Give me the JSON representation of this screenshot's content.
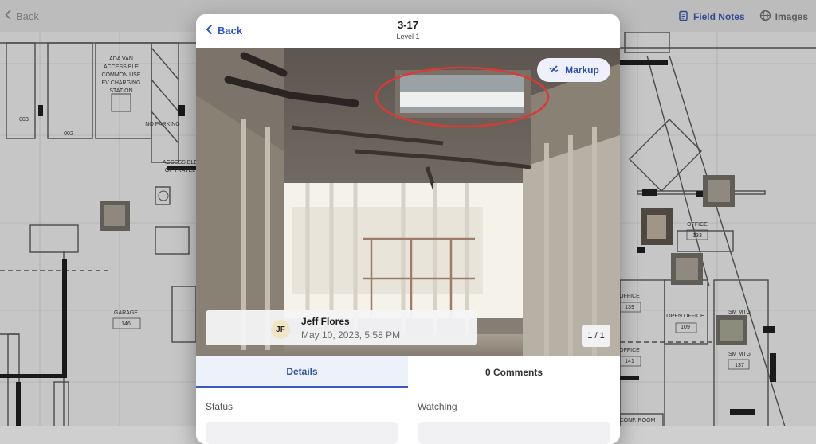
{
  "topbar": {
    "back_label": "Back",
    "field_notes_label": "Field Notes",
    "images_label": "Images",
    "accent_color": "#3b57a8"
  },
  "plan": {
    "labels": [
      "ADA VAN",
      "ACCESSIBLE",
      "COMMON USE",
      "EV CHARGING",
      "STATION",
      "003",
      "002",
      "NO PARKING",
      "ACCESSIBLE",
      "OF TRAVEL",
      "GARAGE",
      "146",
      "OFFICE",
      "133",
      "OFFICE",
      "139",
      "OPEN OFFICE",
      "109",
      "SM MTG",
      "SM MTG",
      "137",
      "OFFICE",
      "141",
      "CONF. ROOM"
    ]
  },
  "modal": {
    "back_label": "Back",
    "title": "3-17",
    "subtitle": "Level 1",
    "markup_label": "Markup",
    "photo_icon": "construction-photo",
    "author": {
      "initials": "JF",
      "name": "Jeff Flores",
      "date": "May 10, 2023, 5:58 PM"
    },
    "page_count": "1 / 1",
    "tabs": [
      {
        "label": "Details",
        "active": true
      },
      {
        "label": "0 Comments",
        "active": false
      }
    ],
    "fields": [
      {
        "label": "Status"
      },
      {
        "label": "Watching"
      }
    ]
  }
}
